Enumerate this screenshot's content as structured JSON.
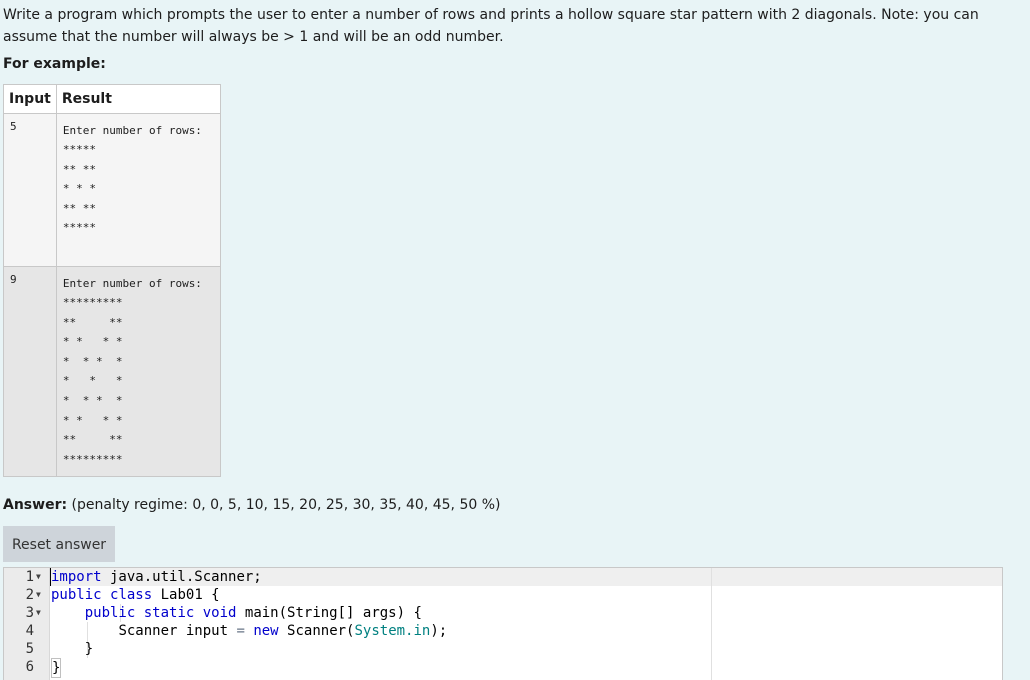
{
  "question": {
    "text": "Write a program which prompts the user to enter a number of rows and prints a hollow square star pattern with 2 diagonals. Note: you can assume that the number will always be > 1 and will be an odd number.",
    "for_example": "For example:"
  },
  "examples": {
    "headers": [
      "Input",
      "Result"
    ],
    "rows": [
      {
        "input": "5",
        "output": [
          "Enter number of rows:",
          "*****",
          "** **",
          "* * *",
          "** **",
          "*****"
        ]
      },
      {
        "input": "9",
        "output": [
          "Enter number of rows:",
          "*********",
          "**     **",
          "* *   * *",
          "*  * *  *",
          "*   *   *",
          "*  * *  *",
          "* *   * *",
          "**     **",
          "*********"
        ]
      }
    ]
  },
  "answer": {
    "label": "Answer:",
    "penalty": "(penalty regime: 0, 0, 5, 10, 15, 20, 25, 30, 35, 40, 45, 50 %)",
    "reset_button": "Reset answer"
  },
  "editor": {
    "lines": [
      {
        "n": "1",
        "fold": true
      },
      {
        "n": "2",
        "fold": true
      },
      {
        "n": "3",
        "fold": true
      },
      {
        "n": "4",
        "fold": false
      },
      {
        "n": "5",
        "fold": false
      },
      {
        "n": "6",
        "fold": false
      }
    ],
    "tokens": {
      "import": "import",
      "import_path": " java.util.Scanner;",
      "public": "public",
      "class": "class",
      "class_name": " Lab01 {",
      "static": "static",
      "void": "void",
      "main_sig": " main(String[] args) {",
      "scanner_decl": "Scanner input ",
      "eq": "=",
      "new": "new",
      "scanner_ctor_a": " Scanner(",
      "system_in": "System.in",
      "scanner_ctor_b": ");",
      "close_brace": "}"
    }
  }
}
